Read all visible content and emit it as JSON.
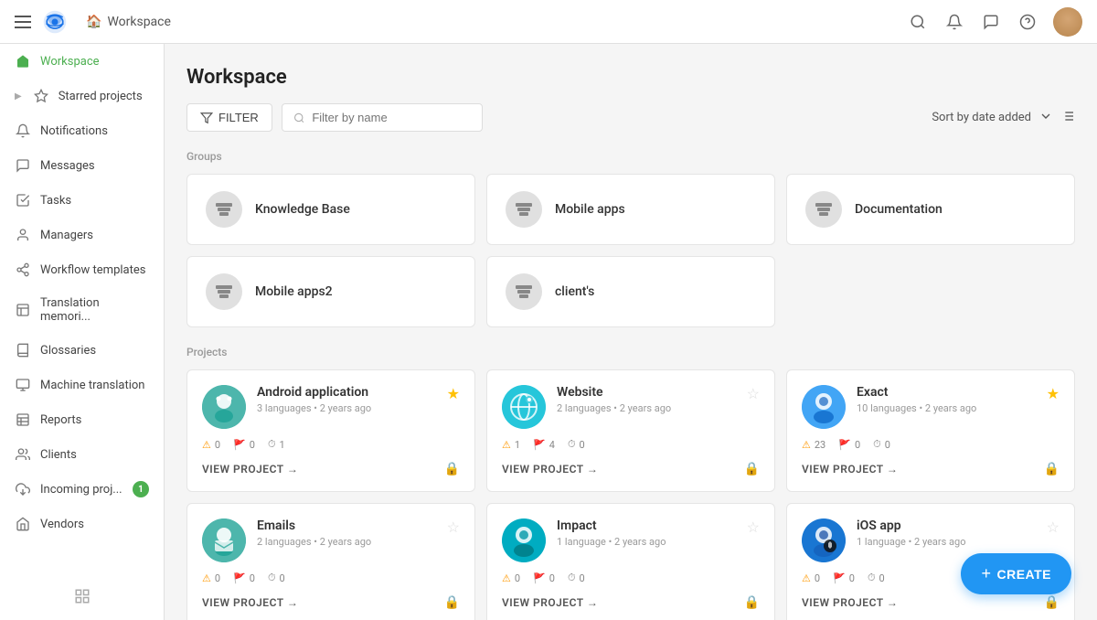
{
  "topnav": {
    "breadcrumb": "Workspace",
    "home_icon": "🏠"
  },
  "sidebar": {
    "items": [
      {
        "id": "workspace",
        "label": "Workspace",
        "icon": "home",
        "active": true
      },
      {
        "id": "starred",
        "label": "Starred projects",
        "icon": "star",
        "active": false
      },
      {
        "id": "notifications",
        "label": "Notifications",
        "icon": "bell",
        "active": false
      },
      {
        "id": "messages",
        "label": "Messages",
        "icon": "comment",
        "active": false
      },
      {
        "id": "tasks",
        "label": "Tasks",
        "icon": "check-square",
        "active": false
      },
      {
        "id": "managers",
        "label": "Managers",
        "icon": "user",
        "active": false
      },
      {
        "id": "workflow",
        "label": "Workflow templates",
        "icon": "workflow",
        "active": false
      },
      {
        "id": "translation",
        "label": "Translation memori...",
        "icon": "translation",
        "active": false
      },
      {
        "id": "glossaries",
        "label": "Glossaries",
        "icon": "glossary",
        "active": false
      },
      {
        "id": "machine",
        "label": "Machine translation",
        "icon": "machine",
        "active": false
      },
      {
        "id": "reports",
        "label": "Reports",
        "icon": "reports",
        "active": false
      },
      {
        "id": "clients",
        "label": "Clients",
        "icon": "clients",
        "active": false
      },
      {
        "id": "incoming",
        "label": "Incoming proj...",
        "icon": "incoming",
        "active": false,
        "badge": "1"
      },
      {
        "id": "vendors",
        "label": "Vendors",
        "icon": "vendors",
        "active": false
      }
    ]
  },
  "main": {
    "title": "Workspace",
    "toolbar": {
      "filter_label": "FILTER",
      "search_placeholder": "Filter by name",
      "sort_label": "Sort by date added"
    },
    "groups_label": "Groups",
    "projects_label": "Projects",
    "groups": [
      {
        "id": "knowledge-base",
        "name": "Knowledge Base"
      },
      {
        "id": "mobile-apps",
        "name": "Mobile apps"
      },
      {
        "id": "documentation",
        "name": "Documentation"
      },
      {
        "id": "mobile-apps2",
        "name": "Mobile apps2"
      },
      {
        "id": "clients",
        "name": "client's"
      }
    ],
    "projects": [
      {
        "id": "android",
        "name": "Android application",
        "meta": "3 languages • 2 years ago",
        "starred": true,
        "stats": {
          "warnings": 0,
          "flags": 0,
          "clocks": 1
        },
        "avatar_class": "android-avatar",
        "view_label": "VIEW PROJECT"
      },
      {
        "id": "website",
        "name": "Website",
        "meta": "2 languages • 2 years ago",
        "starred": false,
        "stats": {
          "warnings": 1,
          "flags": 4,
          "clocks": 0
        },
        "avatar_class": "website-avatar",
        "view_label": "VIEW PROJECT"
      },
      {
        "id": "exact",
        "name": "Exact",
        "meta": "10 languages • 2 years ago",
        "starred": true,
        "stats": {
          "warnings": 23,
          "flags": 0,
          "clocks": 0
        },
        "avatar_class": "exact-avatar",
        "view_label": "VIEW PROJECT"
      },
      {
        "id": "emails",
        "name": "Emails",
        "meta": "2 languages • 2 years ago",
        "starred": false,
        "stats": {
          "warnings": 0,
          "flags": 0,
          "clocks": 0
        },
        "avatar_class": "emails-avatar",
        "view_label": "VIEW PROJECT"
      },
      {
        "id": "impact",
        "name": "Impact",
        "meta": "1 language • 2 years ago",
        "starred": false,
        "stats": {
          "warnings": 0,
          "flags": 0,
          "clocks": 0
        },
        "avatar_class": "impact-avatar",
        "view_label": "VIEW PROJECT"
      },
      {
        "id": "ios",
        "name": "iOS app",
        "meta": "1 language • 2 years ago",
        "starred": false,
        "stats": {
          "warnings": 0,
          "flags": 0,
          "clocks": 0
        },
        "avatar_class": "ios-avatar",
        "view_label": "VIEW PROJECT"
      }
    ]
  },
  "create_button": {
    "label": "CREATE",
    "icon": "+"
  }
}
